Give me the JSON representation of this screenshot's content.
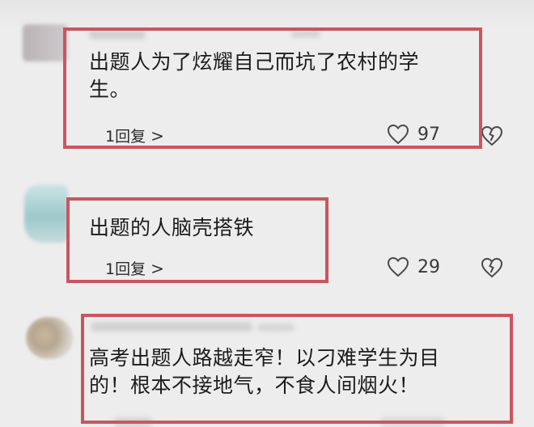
{
  "comments": [
    {
      "text_line1": "出题人为了炫耀自己而坑了农村的学",
      "text_line2": "生。",
      "reply_label": "1回复",
      "reply_chevron": ">",
      "likes": "97"
    },
    {
      "text_line1": "出题的人脑壳搭铁",
      "reply_label": "1回复",
      "reply_chevron": ">",
      "likes": "29"
    },
    {
      "text_line1": "高考出题人路越走窄！以刁难学生为目",
      "text_line2": "的！根本不接地气，不食人间烟火！"
    }
  ],
  "icons": {
    "like": "heart-outline-icon",
    "dislike": "broken-heart-icon"
  },
  "colors": {
    "background": "#ededed",
    "highlight_border": "#c9565f",
    "text": "#1c1c1c"
  }
}
